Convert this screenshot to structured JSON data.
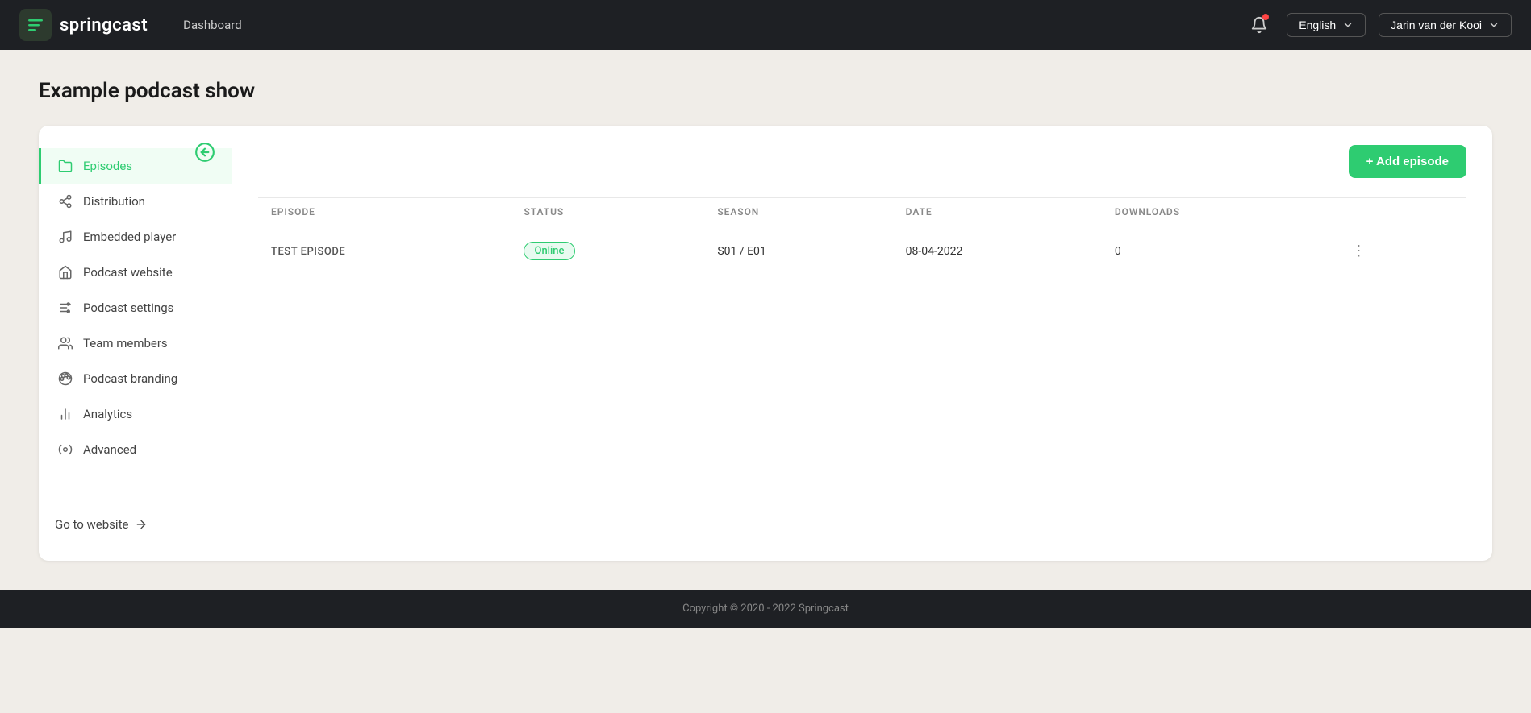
{
  "app": {
    "name": "springcast",
    "nav_link": "Dashboard",
    "footer_text": "Copyright © 2020 - 2022 Springcast"
  },
  "topnav": {
    "language": "English",
    "user": "Jarin van der Kooi"
  },
  "page": {
    "title": "Example podcast show"
  },
  "sidebar": {
    "back_tooltip": "Go back",
    "items": [
      {
        "id": "episodes",
        "label": "Episodes",
        "active": true
      },
      {
        "id": "distribution",
        "label": "Distribution",
        "active": false
      },
      {
        "id": "embedded-player",
        "label": "Embedded player",
        "active": false
      },
      {
        "id": "podcast-website",
        "label": "Podcast website",
        "active": false
      },
      {
        "id": "podcast-settings",
        "label": "Podcast settings",
        "active": false
      },
      {
        "id": "team-members",
        "label": "Team members",
        "active": false
      },
      {
        "id": "podcast-branding",
        "label": "Podcast branding",
        "active": false
      },
      {
        "id": "analytics",
        "label": "Analytics",
        "active": false
      },
      {
        "id": "advanced",
        "label": "Advanced",
        "active": false
      }
    ],
    "footer_link": "Go to website"
  },
  "table": {
    "add_button": "+ Add episode",
    "columns": [
      "EPISODE",
      "STATUS",
      "SEASON",
      "DATE",
      "DOWNLOADS"
    ],
    "rows": [
      {
        "episode": "TEST EPISODE",
        "status": "Online",
        "season": "S01 / E01",
        "date": "08-04-2022",
        "downloads": "0"
      }
    ]
  }
}
